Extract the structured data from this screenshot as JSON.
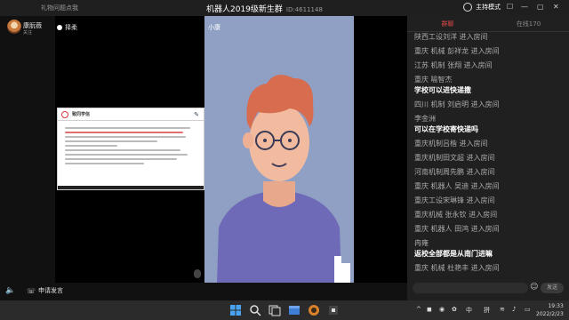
{
  "window": {
    "left_title": "礼物问题点我",
    "title": "机器人2019级新生群",
    "room_id": "ID:4611148",
    "host_mode": "主持模式"
  },
  "host": {
    "name": "康朊薇",
    "follow": "关注"
  },
  "main_view": {
    "label": "择柔",
    "doc_title": "致同学信"
  },
  "speaker_view": {
    "label": "小康"
  },
  "panel": {
    "tabs": [
      "群聊",
      "在线170"
    ],
    "messages": [
      {
        "text": "陕西工设刘洋 进入房间",
        "bold": false
      },
      {
        "text": "重庆 机械 彭祥龙 进入房间",
        "bold": false
      },
      {
        "text": "江苏 机制 张翔 进入房间",
        "bold": false
      },
      {
        "text": "重庆 喻智杰",
        "bold": false
      },
      {
        "text": "学校可以进快递撒",
        "bold": true
      },
      {
        "text": "四川 机制 刘启明 进入房间",
        "bold": false
      },
      {
        "text": "李金洲",
        "bold": false
      },
      {
        "text": "可以在学校寄快递吗",
        "bold": true
      },
      {
        "text": "重庆机制吕楷 进入房间",
        "bold": false
      },
      {
        "text": "重庆机制田文超 进入房间",
        "bold": false
      },
      {
        "text": "河南机制周先鹏 进入房间",
        "bold": false
      },
      {
        "text": "重庆 机器人 吴迪 进入房间",
        "bold": false
      },
      {
        "text": "重庆工设宋琳锋 进入房间",
        "bold": false
      },
      {
        "text": "重庆机械 张永钦 进入房间",
        "bold": false
      },
      {
        "text": "重庆 机器人 田鸿 进入房间",
        "bold": false
      },
      {
        "text": "冉雍",
        "bold": false
      },
      {
        "text": "返校全部都是从南门进嘛",
        "bold": true
      },
      {
        "text": "重庆 机械 杜艳丰 进入房间",
        "bold": false
      }
    ],
    "send_label": "发送"
  },
  "bottom": {
    "apply_label": "申请发言"
  },
  "taskbar": {
    "ime_mode": "中",
    "ime_name": "拼",
    "time": "19:33",
    "date": "2022/2/23"
  },
  "colors": {
    "accent_red": "#e04848",
    "speaker_bg": "#8fa0c4",
    "panel_bg": "#202020"
  }
}
